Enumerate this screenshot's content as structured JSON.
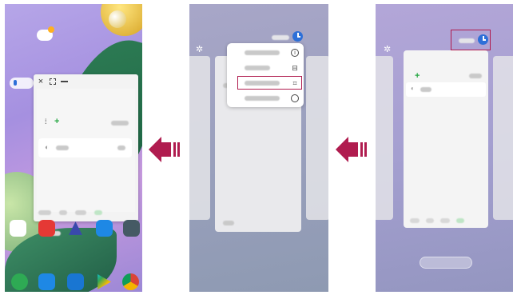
{
  "accent_color": "#b01c4f",
  "panels": [
    {
      "id": "home-with-popup",
      "controls": [
        "close-icon",
        "expand-icon",
        "minimize-icon"
      ]
    },
    {
      "id": "menu-open",
      "menu_icons": [
        "info-icon",
        "split-icon",
        "popup-icon",
        "compass-icon"
      ]
    },
    {
      "id": "recent-apps",
      "highlight": "status-icon"
    }
  ],
  "arrows": [
    "left-arrow",
    "left-arrow"
  ],
  "icons": {
    "settings": "gear-icon",
    "clock": "clock-icon",
    "close": "×",
    "add": "+"
  }
}
